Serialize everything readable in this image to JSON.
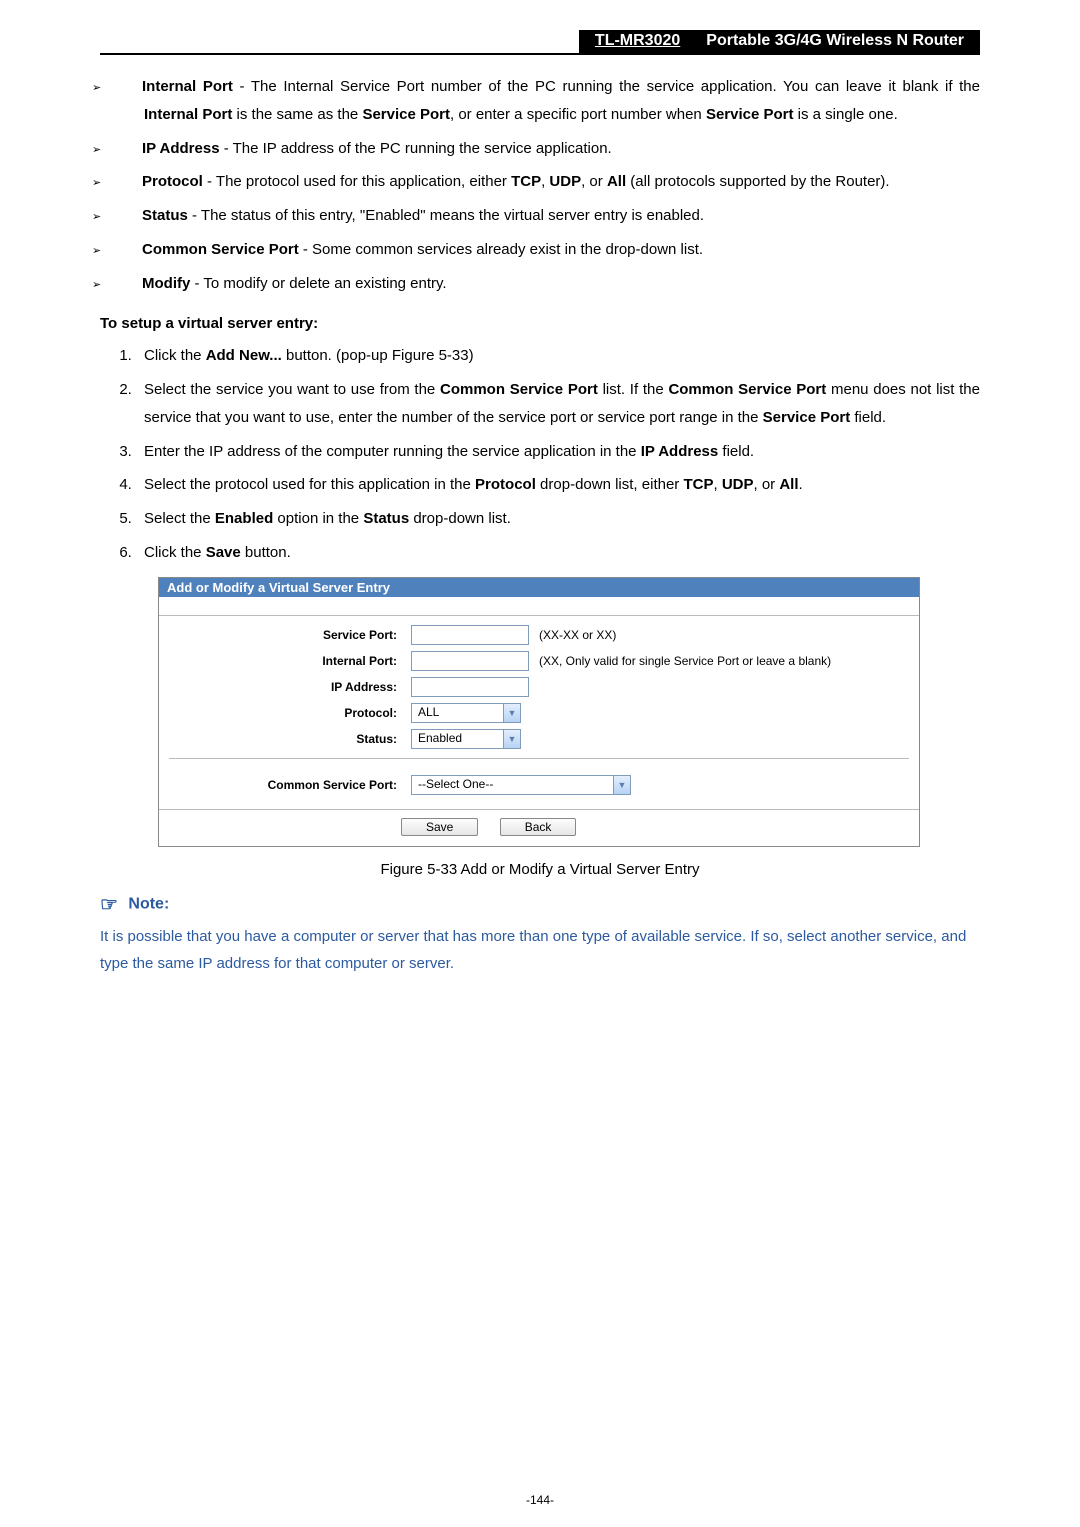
{
  "header": {
    "model": "TL-MR3020",
    "title": "Portable 3G/4G Wireless N Router"
  },
  "bullets": [
    {
      "term": "Internal Port",
      "lines": [
        "- The Internal Service Port number of the PC running the service application. You can leave it blank if the <b>Internal Port</b> is the same as the <b>Service Port</b>, or enter a specific port number when <b>Service Port</b> is a single one."
      ]
    },
    {
      "term": "IP Address",
      "lines": [
        "- The IP address of the PC running the service application."
      ]
    },
    {
      "term": "Protocol",
      "lines": [
        "- The protocol used for this application, either <b>TCP</b>, <b>UDP</b>, or <b>All</b> (all protocols supported by the Router)."
      ]
    },
    {
      "term": "Status",
      "lines": [
        "- The status of this entry, \"Enabled\" means the virtual server entry is enabled."
      ]
    },
    {
      "term": "Common Service Port",
      "lines": [
        "- Some common services already exist in the drop-down list."
      ]
    },
    {
      "term": "Modify",
      "lines": [
        "- To modify or delete an existing entry."
      ]
    }
  ],
  "setup_heading": "To setup a virtual server entry:",
  "steps": [
    "Click the <b>Add New...</b> button. (pop-up Figure 5-33)",
    "Select the service you want to use from the <b>Common Service Port</b> list. If the <b>Common Service Port</b> menu does not list the service that you want to use, enter the number of the service port or service port range in the <b>Service Port</b> field.",
    "Enter the IP address of the computer running the service application in the <b>IP Address</b> field.",
    "Select the protocol used for this application in the <b>Protocol</b> drop-down list, either <b>TCP</b>, <b>UDP</b>, or <b>All</b>.",
    "Select the <b>Enabled</b> option in the <b>Status</b> drop-down list.",
    "Click the <b>Save</b> button."
  ],
  "figure": {
    "title": "Add or Modify a Virtual Server Entry",
    "labels": {
      "service_port": "Service Port:",
      "internal_port": "Internal Port:",
      "ip_address": "IP Address:",
      "protocol": "Protocol:",
      "status": "Status:",
      "common_service_port": "Common Service Port:"
    },
    "hints": {
      "service_port": "(XX-XX or XX)",
      "internal_port": "(XX, Only valid for single Service Port or leave a blank)"
    },
    "values": {
      "protocol": "ALL",
      "status": "Enabled",
      "common_service_port": "--Select One--"
    },
    "buttons": {
      "save": "Save",
      "back": "Back"
    }
  },
  "figure_caption": "Figure 5-33    Add or Modify a Virtual Server Entry",
  "note_heading": "Note:",
  "note_body": "It is possible that you have a computer or server that has more than one type of available service. If so, select another service, and type the same IP address for that computer or server.",
  "page_number": "-144-"
}
